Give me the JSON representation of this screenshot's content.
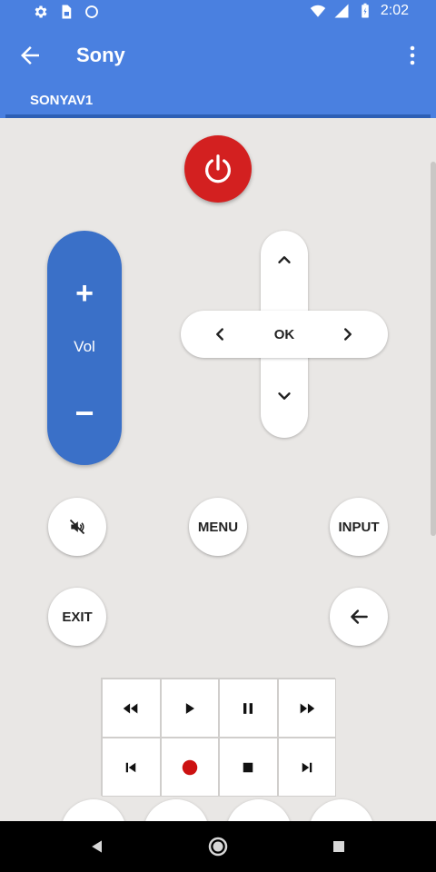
{
  "status_bar": {
    "time": "2:02",
    "icons": [
      "settings-icon",
      "sim-card-icon",
      "circle-icon",
      "wifi-icon",
      "signal-icon",
      "battery-charging-icon"
    ]
  },
  "app_bar": {
    "title": "Sony",
    "back_icon": "arrow-left-icon",
    "menu_icon": "more-vert-icon"
  },
  "tabs": [
    {
      "label": "SONYAV1",
      "selected": true
    }
  ],
  "remote": {
    "power_icon": "power-icon",
    "volume": {
      "plus": "+",
      "label": "Vol",
      "minus": "−"
    },
    "dpad": {
      "ok_label": "OK",
      "up_icon": "chevron-up-icon",
      "down_icon": "chevron-down-icon",
      "left_icon": "chevron-left-icon",
      "right_icon": "chevron-right-icon"
    },
    "mute_icon": "volume-off-icon",
    "menu_label": "MENU",
    "input_label": "INPUT",
    "exit_label": "EXIT",
    "return_icon": "arrow-left-icon",
    "media": [
      "rewind-icon",
      "play-icon",
      "pause-icon",
      "fast-forward-icon",
      "skip-previous-icon",
      "record-icon",
      "stop-icon",
      "skip-next-icon"
    ]
  },
  "colors": {
    "primary": "#4a80e0",
    "volume": "#3a70c8",
    "power": "#d32020",
    "record": "#cc1111",
    "background": "#e9e7e5"
  },
  "nav_bar": {
    "icons": [
      "nav-back-icon",
      "nav-home-icon",
      "nav-recents-icon"
    ]
  }
}
